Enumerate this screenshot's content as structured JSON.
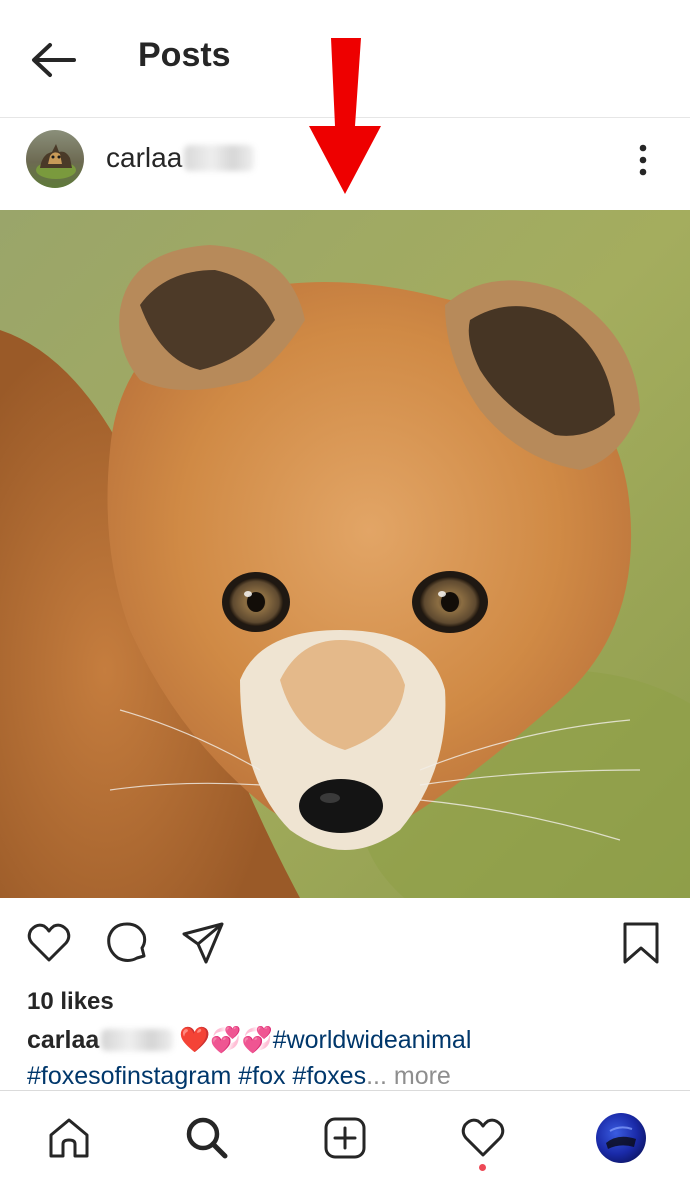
{
  "header": {
    "title": "Posts"
  },
  "post": {
    "username_visible": "carlaa",
    "photo_subject": "Red fox kit close-up",
    "likes": "10 likes",
    "caption": {
      "username_visible": "carlaa",
      "emojis": "❤️💞💞",
      "hashtag_1": "#worldwideanimal",
      "line2_tags": "#foxesofinstagram #fox #foxes",
      "ellipsis": "...",
      "more_label": " more"
    }
  },
  "colors": {
    "text": "#262626",
    "hashtag": "#00376b",
    "muted": "#8e8e8e",
    "annotation_arrow": "#ee0000",
    "notification_dot": "#ed4956"
  },
  "icons": {
    "back": "back-arrow-icon",
    "options": "more-vertical-icon",
    "like": "heart-icon",
    "comment": "comment-icon",
    "share": "paper-plane-icon",
    "save": "bookmark-icon",
    "home": "home-icon",
    "search": "search-icon",
    "create": "add-post-icon",
    "activity": "heart-icon",
    "profile": "profile-avatar"
  }
}
